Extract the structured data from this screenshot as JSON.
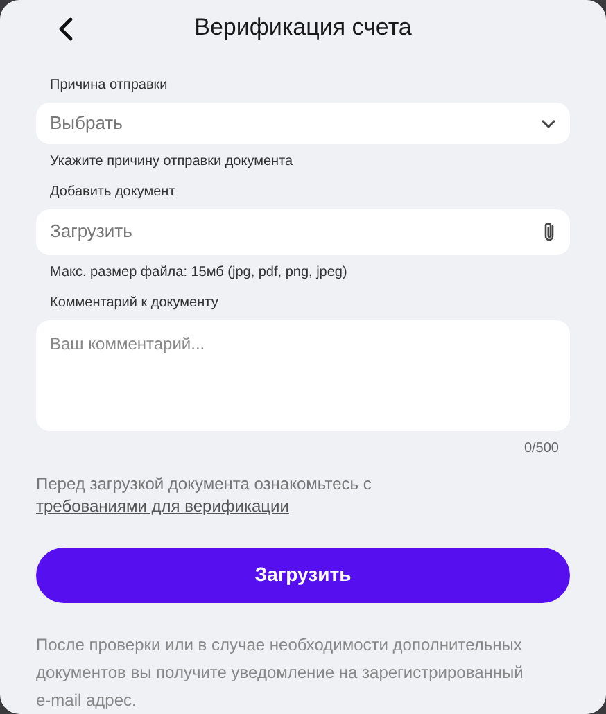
{
  "header": {
    "title": "Верификация счета"
  },
  "reason": {
    "label": "Причина отправки",
    "placeholder": "Выбрать",
    "hint": "Укажите причину отправки документа"
  },
  "document": {
    "label": "Добавить документ",
    "placeholder": "Загрузить",
    "hint": "Макс. размер файла: 15мб (jpg, pdf, png, jpeg)"
  },
  "comment": {
    "label": "Комментарий к документу",
    "placeholder": "Ваш комментарий...",
    "counter": "0/500"
  },
  "notice": {
    "text": "Перед загрузкой документа ознакомьтесь с",
    "link": "требованиями для верификации"
  },
  "submit": "Загрузить",
  "footer": "После проверки или в случае необходимости дополнительных документов вы получите уведомление на зарегистрированный e-mail адрес."
}
